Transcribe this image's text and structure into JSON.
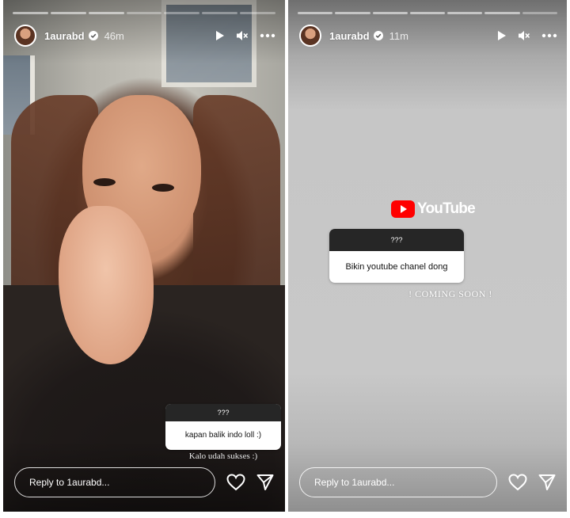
{
  "stories": [
    {
      "username": "1aurabd",
      "time": "46m",
      "question_header": "???",
      "question": "kapan balik indo loll :)",
      "answer": "Kalo udah sukses :)",
      "reply_placeholder": "Reply to 1aurabd..."
    },
    {
      "username": "1aurabd",
      "time": "11m",
      "brand": "YouTube",
      "question_header": "???",
      "question": "Bikin youtube chanel dong",
      "answer": "! COMING SOON !",
      "reply_placeholder": "Reply to 1aurabd..."
    }
  ],
  "icons": {
    "header": [
      "verified-badge-icon",
      "play-icon",
      "mute-icon",
      "more-icon"
    ],
    "footer": [
      "heart-icon",
      "send-icon"
    ]
  },
  "colors": {
    "youtube_red": "#ff0000",
    "question_header_bg": "#262626"
  }
}
